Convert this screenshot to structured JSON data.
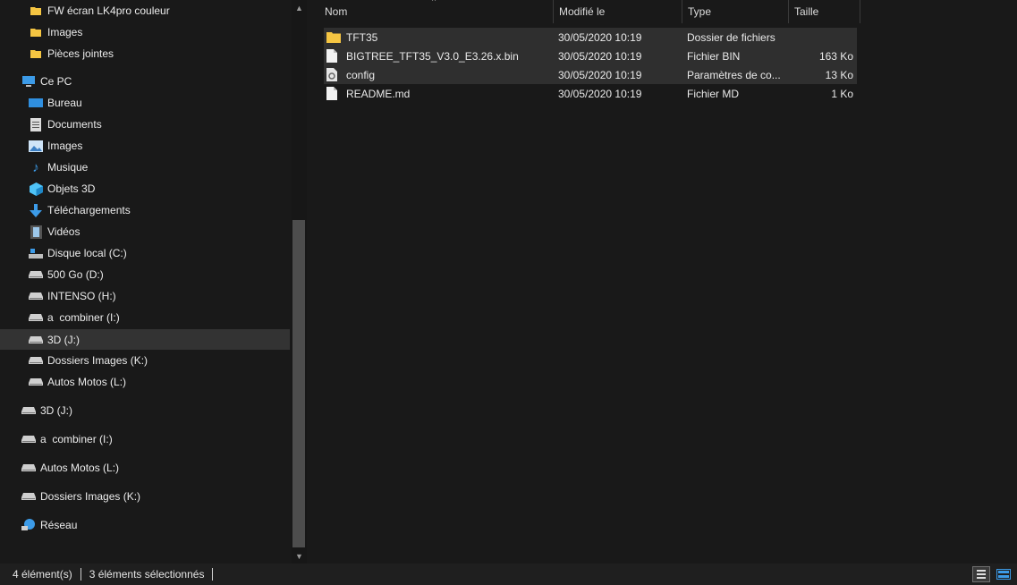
{
  "navigation": {
    "items": [
      {
        "label": "FW écran LK4pro couleur",
        "icon": "folder-icon",
        "pinned": true
      },
      {
        "label": "Images",
        "icon": "folder-icon",
        "pinned": true
      },
      {
        "label": "Pièces jointes",
        "icon": "folder-icon",
        "pinned": false
      },
      {
        "label": "Ce PC",
        "icon": "pc-icon"
      },
      {
        "label": "Bureau",
        "icon": "desktop-icon"
      },
      {
        "label": "Documents",
        "icon": "documents-icon"
      },
      {
        "label": "Images",
        "icon": "pictures-icon"
      },
      {
        "label": "Musique",
        "icon": "music-icon"
      },
      {
        "label": "Objets 3D",
        "icon": "3d-objects-icon"
      },
      {
        "label": "Téléchargements",
        "icon": "download-icon"
      },
      {
        "label": "Vidéos",
        "icon": "videos-icon"
      },
      {
        "label": "Disque local (C:)",
        "icon": "system-drive-icon"
      },
      {
        "label": "500 Go (D:)",
        "icon": "drive-icon"
      },
      {
        "label": "INTENSO (H:)",
        "icon": "drive-icon"
      },
      {
        "label": "a  combiner (I:)",
        "icon": "drive-icon"
      },
      {
        "label": "3D (J:)",
        "icon": "drive-icon",
        "selected": true
      },
      {
        "label": "Dossiers Images (K:)",
        "icon": "drive-icon"
      },
      {
        "label": "Autos Motos (L:)",
        "icon": "drive-icon"
      },
      {
        "label": "3D (J:)",
        "icon": "drive-icon"
      },
      {
        "label": "a  combiner (I:)",
        "icon": "drive-icon"
      },
      {
        "label": "Autos Motos (L:)",
        "icon": "drive-icon"
      },
      {
        "label": "Dossiers Images (K:)",
        "icon": "drive-icon"
      },
      {
        "label": "Réseau",
        "icon": "network-icon"
      }
    ]
  },
  "columns": {
    "name": "Nom",
    "modified": "Modifié le",
    "type": "Type",
    "size": "Taille"
  },
  "files": [
    {
      "name": "TFT35",
      "modified": "30/05/2020 10:19",
      "type": "Dossier de fichiers",
      "size": "",
      "icon": "folder-icon",
      "selected": true
    },
    {
      "name": "BIGTREE_TFT35_V3.0_E3.26.x.bin",
      "modified": "30/05/2020 10:19",
      "type": "Fichier BIN",
      "size": "163 Ko",
      "icon": "file-icon",
      "selected": true
    },
    {
      "name": "config",
      "modified": "30/05/2020 10:19",
      "type": "Paramètres de co...",
      "size": "13 Ko",
      "icon": "config-file-icon",
      "selected": true
    },
    {
      "name": "README.md",
      "modified": "30/05/2020 10:19",
      "type": "Fichier MD",
      "size": "1 Ko",
      "icon": "file-icon",
      "selected": false
    }
  ],
  "status": {
    "count": "4 élément(s)",
    "selection": "3 éléments sélectionnés"
  },
  "colors": {
    "background": "#191919",
    "selected": "#333333",
    "folder": "#f5c542",
    "accent": "#3c9be8"
  }
}
